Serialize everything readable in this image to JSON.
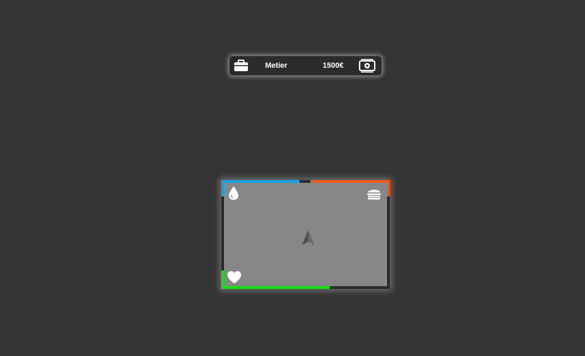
{
  "job_bar": {
    "job_label": "Metier",
    "salary": "1500€",
    "icons": {
      "job": "briefcase-icon",
      "money": "money-icon"
    }
  },
  "status": {
    "thirst": {
      "level": 0.46,
      "color": "#1aa3e0",
      "icon": "water-drop-icon"
    },
    "hunger": {
      "level": 0.49,
      "color": "#ef5a16",
      "icon": "burger-icon"
    },
    "health": {
      "level": 0.64,
      "color": "#16e016",
      "icon": "heart-icon"
    }
  },
  "minimap": {
    "background": "#878787",
    "player_icon": "navigation-arrow-icon"
  }
}
